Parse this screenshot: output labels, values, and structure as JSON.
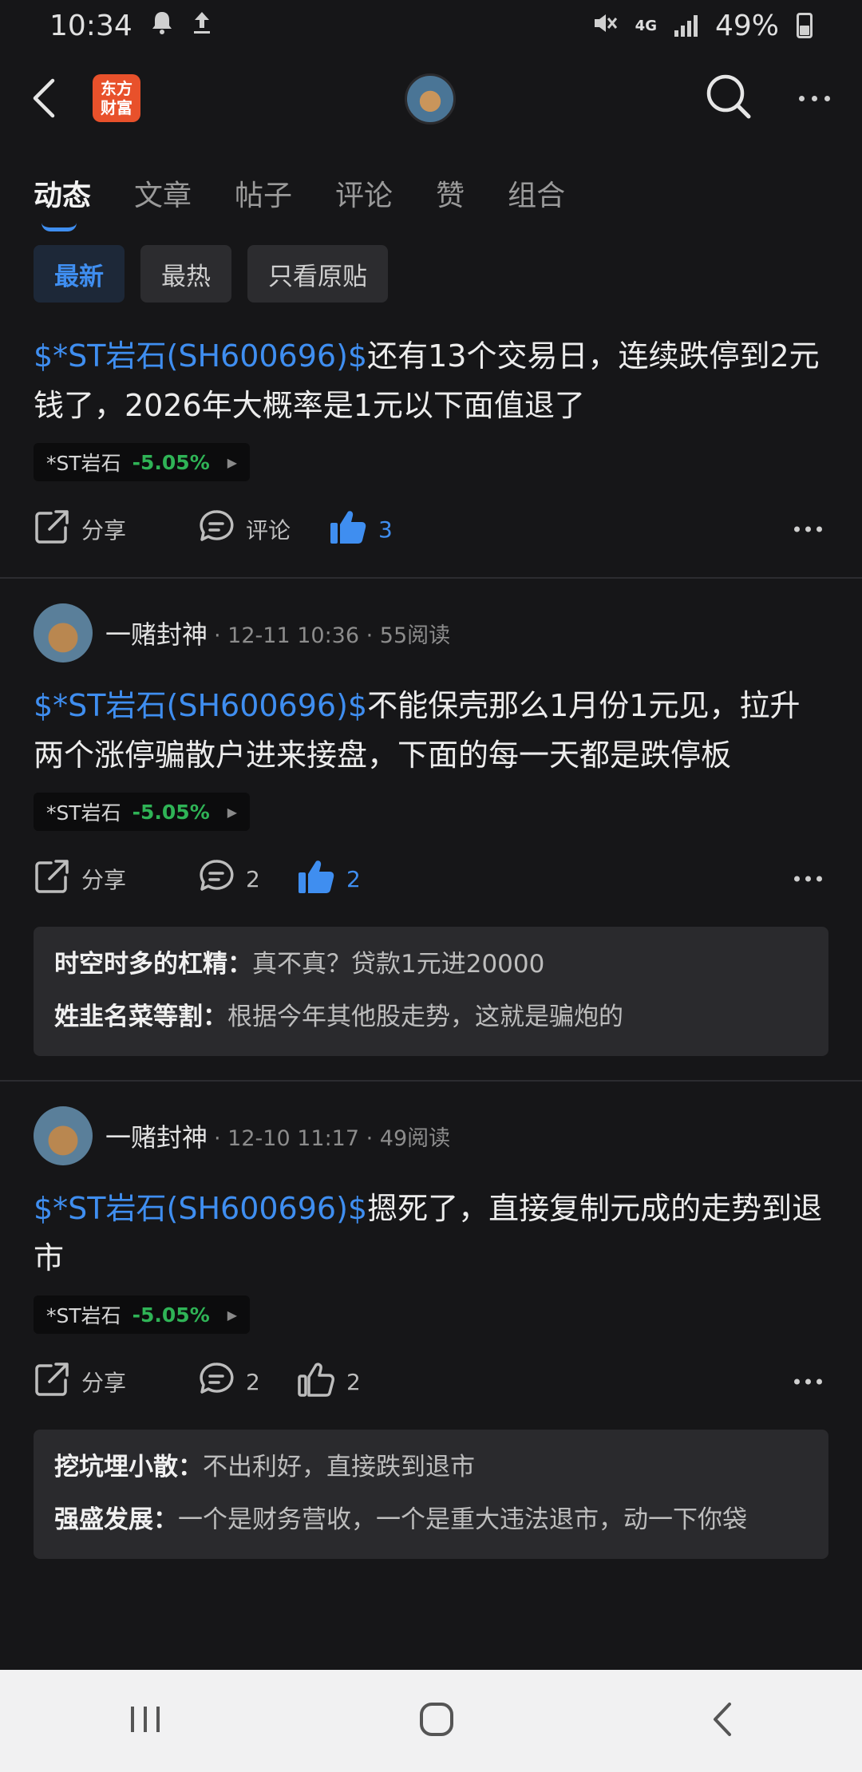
{
  "status": {
    "time": "10:34",
    "network": "4G",
    "battery": "49%"
  },
  "header": {
    "logo_line1": "东方",
    "logo_line2": "财富"
  },
  "tabs": [
    {
      "label": "动态"
    },
    {
      "label": "文章"
    },
    {
      "label": "帖子"
    },
    {
      "label": "评论"
    },
    {
      "label": "赞"
    },
    {
      "label": "组合"
    }
  ],
  "filters": [
    {
      "label": "最新"
    },
    {
      "label": "最热"
    },
    {
      "label": "只看原贴"
    }
  ],
  "posts": [
    {
      "stock_link": "$*ST岩石(SH600696)$",
      "text": "还有13个交易日，连续跌停到2元钱了，2026年大概率是1元以下面值退了",
      "chip_name": "*ST岩石",
      "chip_change": "-5.05%",
      "share_label": "分享",
      "comment_label": "评论",
      "like_count": "3"
    },
    {
      "author": "一赌封神",
      "meta": "· 12-11 10:36 · 55阅读",
      "stock_link": "$*ST岩石(SH600696)$",
      "text": "不能保壳那么1月份1元见，拉升两个涨停骗散户进来接盘，下面的每一天都是跌停板",
      "chip_name": "*ST岩石",
      "chip_change": "-5.05%",
      "share_label": "分享",
      "comment_count": "2",
      "like_count": "2",
      "comments": [
        {
          "name": "时空时多的杠精：",
          "text": "真不真？贷款1元进20000"
        },
        {
          "name": "姓韭名菜等割：",
          "text": "根据今年其他股走势，这就是骗炮的"
        }
      ]
    },
    {
      "author": "一赌封神",
      "meta": "· 12-10 11:17 · 49阅读",
      "stock_link": "$*ST岩石(SH600696)$",
      "text": "摁死了，直接复制元成的走势到退市",
      "chip_name": "*ST岩石",
      "chip_change": "-5.05%",
      "share_label": "分享",
      "comment_count": "2",
      "like_count": "2",
      "comments": [
        {
          "name": "挖坑埋小散：",
          "text": "不出利好，直接跌到退市"
        },
        {
          "name": "强盛发展：",
          "text": "一个是财务营收，一个是重大违法退市，动一下你袋"
        }
      ]
    }
  ]
}
